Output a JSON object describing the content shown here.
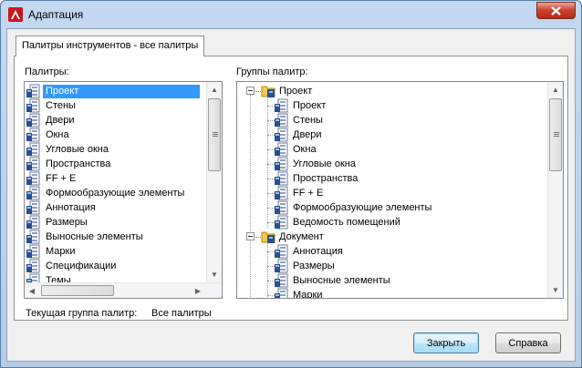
{
  "window": {
    "title": "Адаптация"
  },
  "tab": {
    "label": "Палитры инструментов - все палитры"
  },
  "palettes": {
    "label": "Палитры:",
    "items": [
      "Проект",
      "Стены",
      "Двери",
      "Окна",
      "Угловые окна",
      "Пространства",
      "FF + E",
      "Формообразующие элементы",
      "Аннотация",
      "Размеры",
      "Выносные элементы",
      "Марки",
      "Спецификации",
      "Темы"
    ],
    "selected_index": 0
  },
  "groups": {
    "label": "Группы палитр:",
    "tree": [
      {
        "label": "Проект",
        "children": [
          "Проект",
          "Стены",
          "Двери",
          "Окна",
          "Угловые окна",
          "Пространства",
          "FF + E",
          "Формообразующие элементы",
          "Ведомость помещений"
        ]
      },
      {
        "label": "Документ",
        "children": [
          "Аннотация",
          "Размеры",
          "Выносные элементы",
          "Марки"
        ]
      }
    ]
  },
  "current_group": {
    "label": "Текущая группа палитр:",
    "value": "Все палитры"
  },
  "buttons": {
    "close": "Закрыть",
    "help": "Справка"
  },
  "colors": {
    "selection": "#3399ff",
    "close_button": "#c7402d",
    "window_frame": "#b6cde6"
  }
}
